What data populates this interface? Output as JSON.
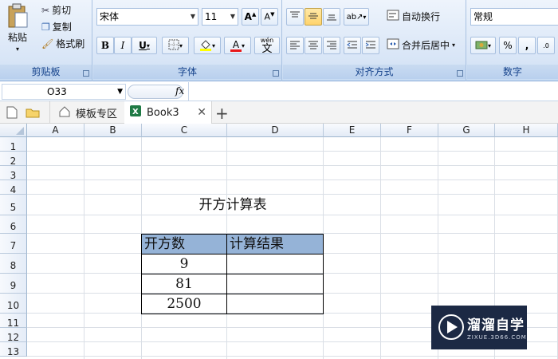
{
  "ribbon": {
    "clipboard": {
      "paste": "粘贴",
      "cut": "剪切",
      "copy": "复制",
      "format_painter": "格式刷",
      "label": "剪贴板"
    },
    "font": {
      "name": "宋体",
      "size": "11",
      "bold": "B",
      "italic": "I",
      "underline": "U",
      "phonetic": "wén",
      "label": "字体"
    },
    "alignment": {
      "wrap_text": "自动换行",
      "merge_center": "合并后居中",
      "label": "对齐方式"
    },
    "number": {
      "format": "常规",
      "percent": "%",
      "comma": ",",
      "label": "数字"
    }
  },
  "formula_bar": {
    "name_box": "O33",
    "fx": "fx",
    "value": ""
  },
  "tabs": [
    {
      "label": "模板专区"
    },
    {
      "label": "Book3"
    }
  ],
  "sheet": {
    "columns": [
      "A",
      "B",
      "C",
      "D",
      "E",
      "F",
      "G",
      "H"
    ],
    "rows": [
      "1",
      "2",
      "3",
      "4",
      "5",
      "6",
      "7",
      "8",
      "9",
      "10",
      "11",
      "12",
      "13"
    ],
    "title": "开方计算表",
    "table": {
      "headers": [
        "开方数",
        "计算结果"
      ],
      "rows": [
        [
          "9",
          ""
        ],
        [
          "81",
          ""
        ],
        [
          "2500",
          ""
        ]
      ]
    },
    "header_fill": "#95b3d7"
  },
  "watermark": {
    "brand": "溜溜自学",
    "url": "ZIXUE.3D66.COM"
  }
}
